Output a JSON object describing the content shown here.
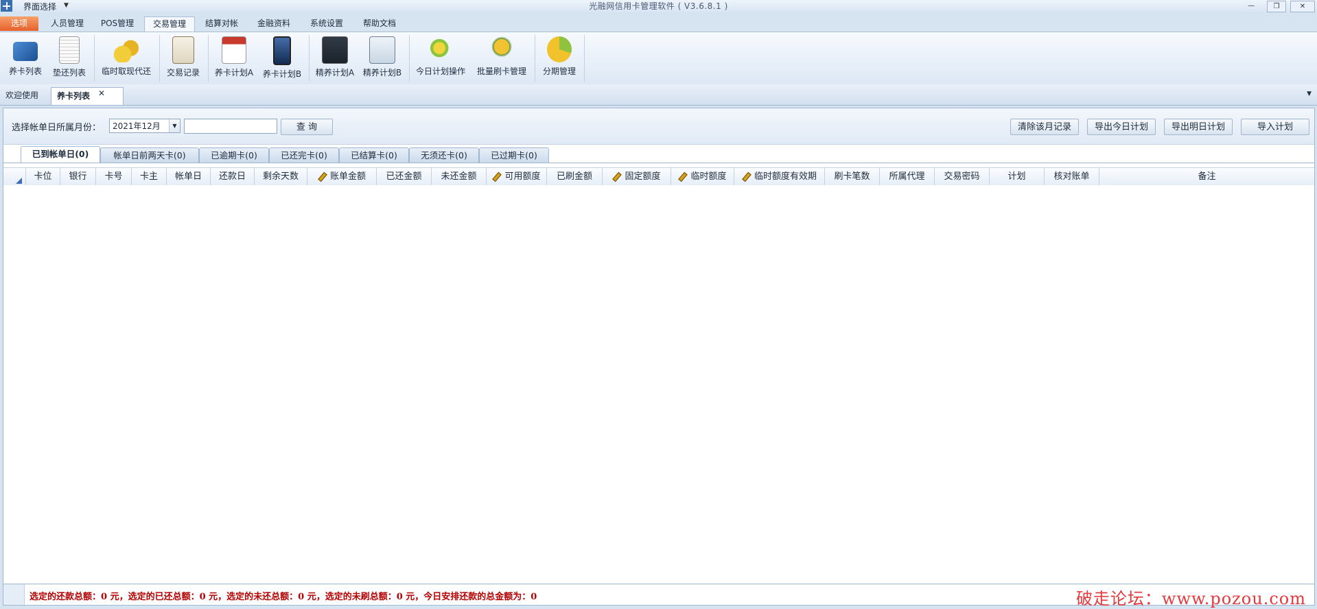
{
  "window": {
    "title": "光融网信用卡管理软件 ( V3.6.8.1 )",
    "quick_menu": "界面选择",
    "min": "—",
    "max": "❐",
    "close": "✕"
  },
  "ribbon_tabs": [
    "选项",
    "人员管理",
    "POS管理",
    "交易管理",
    "结算对帐",
    "金融资料",
    "系统设置",
    "帮助文档"
  ],
  "ribbon_buttons": [
    {
      "label": "养卡列表",
      "icon": "credit-card-icon"
    },
    {
      "label": "垫还列表",
      "icon": "document-list-icon"
    },
    {
      "label": "临时取现代还",
      "icon": "coins-icon"
    },
    {
      "label": "交易记录",
      "icon": "clipboard-icon"
    },
    {
      "label": "养卡计划A",
      "icon": "calendar-icon"
    },
    {
      "label": "养卡计划B",
      "icon": "phone-icon"
    },
    {
      "label": "精养计划A",
      "icon": "chart-terminal-icon"
    },
    {
      "label": "精养计划B",
      "icon": "chart-screen-icon"
    },
    {
      "label": "今日计划操作",
      "icon": "globe-arrow-icon"
    },
    {
      "label": "批量刷卡管理",
      "icon": "coin-ball-icon"
    },
    {
      "label": "分期管理",
      "icon": "pie-chart-icon"
    }
  ],
  "doc_tabs": [
    "欢迎使用",
    "养卡列表"
  ],
  "filter": {
    "label": "选择帐单日所属月份：",
    "month": "2021年12月",
    "search_value": "",
    "query_button": "查 询",
    "clear_button": "清除该月记录",
    "export_today": "导出今日计划",
    "export_tomorrow": "导出明日计划",
    "import_plan": "导入计划"
  },
  "status_tabs": [
    "已到帐单日(0)",
    "帐单日前两天卡(0)",
    "已逾期卡(0)",
    "已还完卡(0)",
    "已结算卡(0)",
    "无须还卡(0)",
    "已过期卡(0)"
  ],
  "columns": [
    "卡位",
    "银行",
    "卡号",
    "卡主",
    "帐单日",
    "还款日",
    "剩余天数",
    "账单金额",
    "已还金额",
    "未还金额",
    "可用额度",
    "已刷金额",
    "固定额度",
    "临时额度",
    "临时额度有效期",
    "刷卡笔数",
    "所属代理",
    "交易密码",
    "计划",
    "核对账单",
    "备注"
  ],
  "status_bar": {
    "summary": "选定的还款总额：0 元，选定的已还总额：0 元，选定的未还总额：0 元，选定的未刷总额：0 元，今日安排还款的总金额为：0",
    "watermark": "破走论坛：www.pozou.com"
  }
}
